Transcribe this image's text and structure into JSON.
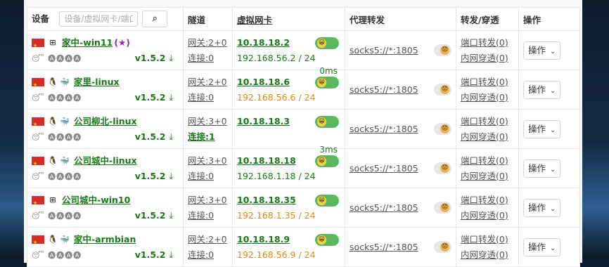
{
  "header": {
    "device": "设备",
    "search_placeholder": "设备/虚拟网卡/端口",
    "tunnel": "隧道",
    "vnic": "虚拟网卡",
    "proxy": "代理转发",
    "forward": "转发/穿透",
    "ops": "操作"
  },
  "rows": [
    {
      "name": "家中-win11",
      "star": "(★)",
      "os": "windows",
      "emojis": "😴 🅐🅐🅐🅐",
      "version": "v1.5.2",
      "gw": "网关:2+0",
      "conn": "连接:0",
      "conn_active": false,
      "ip": "10.18.18.2",
      "lan": "192.168.56.2 / 24",
      "lan_color": "green",
      "latency": "0ms",
      "proxy": "socks5://*:1805",
      "pf": "端口转发(0)",
      "nat": "内网穿透(0)",
      "op": "操作"
    },
    {
      "name": "家里-linux",
      "star": "",
      "os": "linux",
      "emojis": "😴 🅐🅐🅐🅐",
      "version": "v1.5.2",
      "gw": "网关:2+0",
      "conn": "连接:0",
      "conn_active": false,
      "ip": "10.18.18.6",
      "lan": "192.168.56.6 / 24",
      "lan_color": "orange",
      "latency": "",
      "proxy": "socks5://*:1805",
      "pf": "端口转发(0)",
      "nat": "内网穿透(0)",
      "op": "操作"
    },
    {
      "name": "公司柳北-linux",
      "star": "",
      "os": "linux",
      "emojis": "😴 🅐🅐🅐🅐",
      "version": "v1.5.2",
      "gw": "网关:3+0",
      "conn": "连接:1",
      "conn_active": true,
      "ip": "10.18.18.3",
      "lan": "",
      "lan_color": "green",
      "latency": "3ms",
      "proxy": "socks5://*:1805",
      "pf": "端口转发(0)",
      "nat": "内网穿透(0)",
      "op": "操作"
    },
    {
      "name": "公司城中-linux",
      "star": "",
      "os": "linux",
      "emojis": "😴 🅐🅐🅐🅐",
      "version": "v1.5.2",
      "gw": "网关:3+0",
      "conn": "连接:0",
      "conn_active": false,
      "ip": "10.18.18.18",
      "lan": "192.168.1.18 / 24",
      "lan_color": "green",
      "latency": "",
      "proxy": "socks5://*:1805",
      "pf": "端口转发(0)",
      "nat": "内网穿透(0)",
      "op": "操作"
    },
    {
      "name": "公司城中-win10",
      "star": "",
      "os": "windows",
      "emojis": "😴 🅐🅐🅐🅐",
      "version": "v1.5.2",
      "gw": "网关:3+0",
      "conn": "连接:0",
      "conn_active": false,
      "ip": "10.18.18.35",
      "lan": "192.168.1.35 / 24",
      "lan_color": "orange",
      "latency": "",
      "proxy": "socks5://*:1805",
      "pf": "端口转发(0)",
      "nat": "内网穿透(0)",
      "op": "操作"
    },
    {
      "name": "家中-armbian",
      "star": "",
      "os": "linux",
      "emojis": "😴 🅐🅐🅐🅐",
      "version": "v1.5.2",
      "gw": "网关:2+0",
      "conn": "连接:0",
      "conn_active": false,
      "ip": "10.18.18.9",
      "lan": "192.168.56.9 / 24",
      "lan_color": "orange",
      "latency": "",
      "proxy": "socks5://*:1805",
      "pf": "端口转发(0)",
      "nat": "内网穿透(0)",
      "op": "操作"
    }
  ],
  "icons": {
    "flag": "china-flag-icon",
    "windows": "windows-logo-icon",
    "linux": "linux-tux-icon",
    "docker": "docker-whale-icon",
    "download": "download-icon",
    "online": "online-smiley-icon",
    "offline": "offline-sad-icon",
    "search": "search-icon",
    "chevron": "chevron-down-icon"
  },
  "colors": {
    "green": "#1a7a1a",
    "orange": "#e08a1f",
    "toggle_on": "#5cb85c",
    "star": "#9b27b0"
  }
}
